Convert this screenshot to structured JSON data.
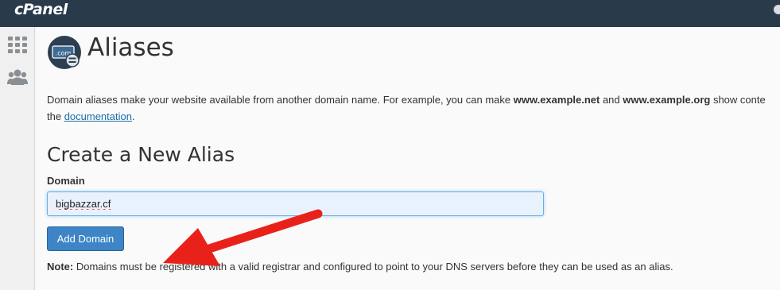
{
  "header": {
    "brand": "cPanel"
  },
  "sidebar": {
    "items": [
      {
        "icon": "grid-icon"
      },
      {
        "icon": "users-icon"
      }
    ]
  },
  "page": {
    "title": "Aliases",
    "icon": "dotcom-domain-icon",
    "description": {
      "part1": "Domain aliases make your website available from another domain name. For example, you can make ",
      "example1": "www.example.net",
      "part2": " and ",
      "example2": "www.example.org",
      "part3": " show conte",
      "line2_prefix": "the ",
      "doc_link": "documentation",
      "line2_suffix": "."
    }
  },
  "form": {
    "section_title": "Create a New Alias",
    "domain_label": "Domain",
    "domain_value": "bigbazzar.cf",
    "submit_label": "Add Domain"
  },
  "note": {
    "label": "Note:",
    "text": " Domains must be registered with a valid registrar and configured to point to your DNS servers before they can be used as an alias."
  },
  "annotation": {
    "arrow_color": "#e8221b"
  },
  "colors": {
    "header_bg": "#293a4a",
    "primary_button": "#3d85c6",
    "link": "#1c6ea6"
  }
}
